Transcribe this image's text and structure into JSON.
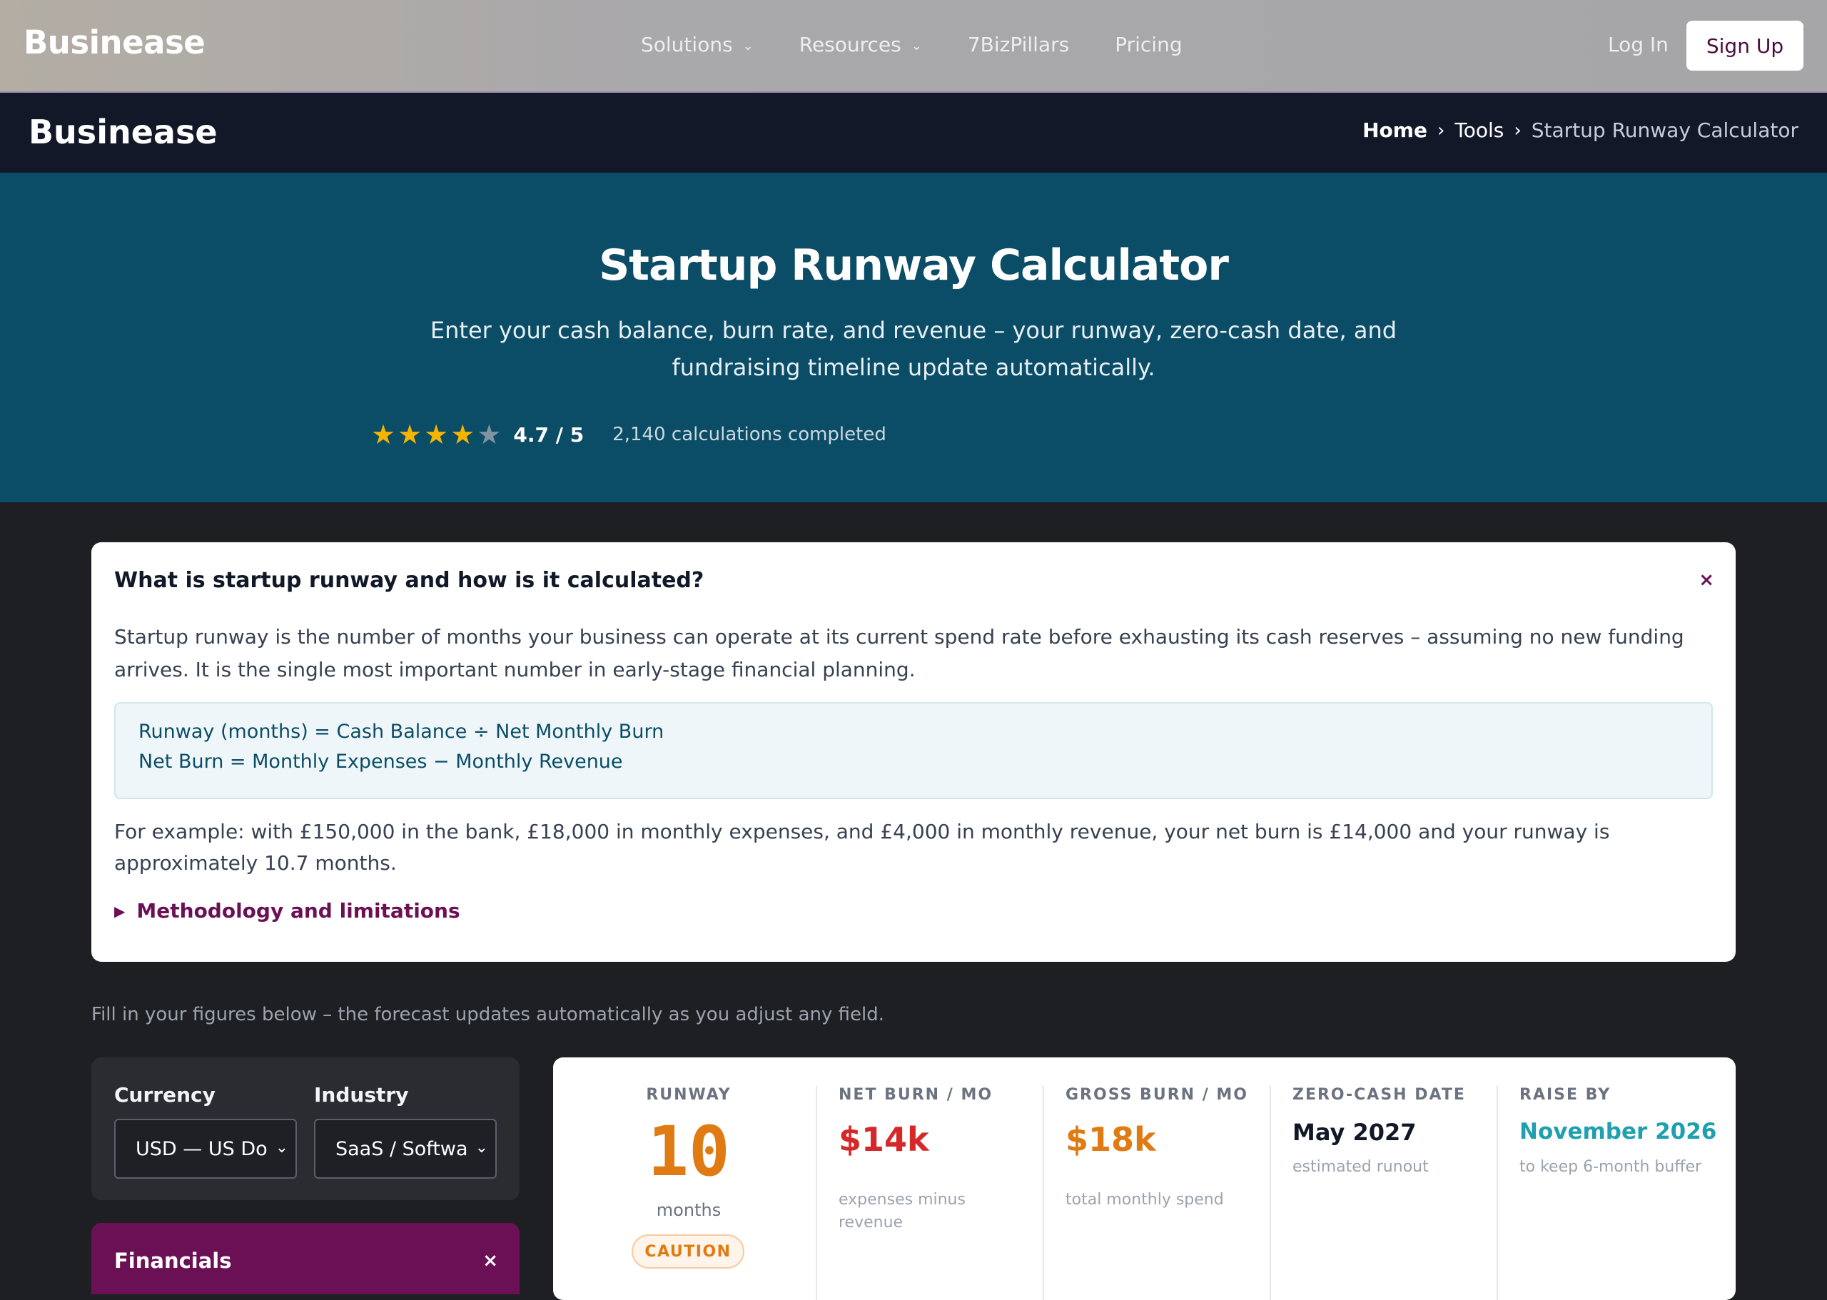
{
  "topnav": {
    "brand": "Businease",
    "items": [
      {
        "label": "Solutions",
        "has_dropdown": true
      },
      {
        "label": "Resources",
        "has_dropdown": true
      },
      {
        "label": "7BizPillars",
        "has_dropdown": false
      },
      {
        "label": "Pricing",
        "has_dropdown": false
      }
    ],
    "login": "Log In",
    "signup": "Sign Up"
  },
  "subbar": {
    "brand": "Businease",
    "breadcrumb": [
      "Home",
      "Tools",
      "Startup Runway Calculator"
    ]
  },
  "hero": {
    "title": "Startup Runway Calculator",
    "subtitle": "Enter your cash balance, burn rate, and revenue – your runway, zero-cash date, and fundraising timeline update automatically.",
    "rating_value": 4.7,
    "rating_text": "4.7 / 5",
    "calculations": "2,140 calculations completed"
  },
  "info": {
    "question": "What is startup runway and how is it calculated?",
    "close": "×",
    "paragraph1": "Startup runway is the number of months your business can operate at its current spend rate before exhausting its cash reserves – assuming no new funding arrives. It is the single most important number in early-stage financial planning.",
    "formula1": "Runway (months) = Cash Balance ÷ Net Monthly Burn",
    "formula2": "Net Burn = Monthly Expenses − Monthly Revenue",
    "paragraph2": "For example: with £150,000 in the bank, £18,000 in monthly expenses, and £4,000 in monthly revenue, your net burn is £14,000 and your runway is approximately 10.7 months.",
    "methodology": "Methodology and limitations"
  },
  "fill_note": "Fill in your figures below – the forecast updates automatically as you adjust any field.",
  "settings": {
    "currency_label": "Currency",
    "currency_value": "USD — US Do",
    "industry_label": "Industry",
    "industry_value": "SaaS / Softwa"
  },
  "financials": {
    "title": "Financials",
    "close": "×"
  },
  "results": {
    "runway": {
      "label": "RUNWAY",
      "value": "10",
      "unit": "months",
      "status": "CAUTION"
    },
    "net_burn": {
      "label": "NET BURN / MO",
      "value": "$14k",
      "note": "expenses minus revenue"
    },
    "gross_burn": {
      "label": "GROSS BURN / MO",
      "value": "$18k",
      "note": "total monthly spend"
    },
    "zero_cash": {
      "label": "ZERO-CASH DATE",
      "value": "May 2027",
      "note": "estimated runout"
    },
    "raise_by": {
      "label": "RAISE BY",
      "value": "November 2026",
      "note": "to keep 6-month buffer"
    }
  },
  "colors": {
    "accent": "#6b1054",
    "hero_bg": "#0b4d66",
    "caution": "#e07a12",
    "danger": "#d62828",
    "teal": "#1f9fb0"
  }
}
